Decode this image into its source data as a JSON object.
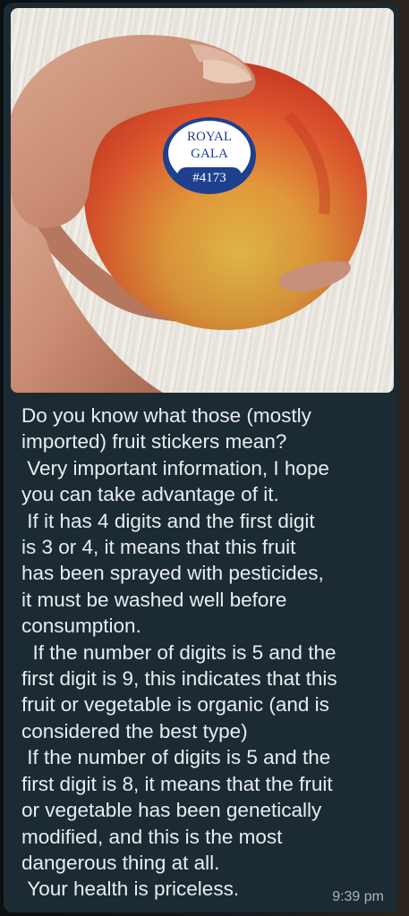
{
  "photo": {
    "sticker": {
      "line1": "ROYAL",
      "line2": "GALA",
      "plu": "#4173"
    }
  },
  "message": {
    "lines": [
      "Do you know what those (mostly",
      "imported) fruit stickers mean?",
      " Very important information, I hope",
      "you can take advantage of it.",
      " If it has 4 digits and the first digit",
      "is 3 or 4, it means that this fruit",
      "has been sprayed with pesticides,",
      "it must be washed well before",
      "consumption.",
      "  If the number of digits is 5 and the",
      "first digit is 9, this indicates that this",
      "fruit or vegetable is organic (and is",
      "considered the best type)",
      " If the number of digits is 5 and the",
      "first digit is 8, it means that the fruit",
      "or vegetable has been genetically",
      "modified, and this is the most",
      "dangerous thing at all.",
      " Your health is priceless."
    ],
    "time": "9:39 pm"
  },
  "colors": {
    "bubble": "#1c2a33",
    "text": "#e9edef",
    "timestamp": "#a9b4ba"
  }
}
